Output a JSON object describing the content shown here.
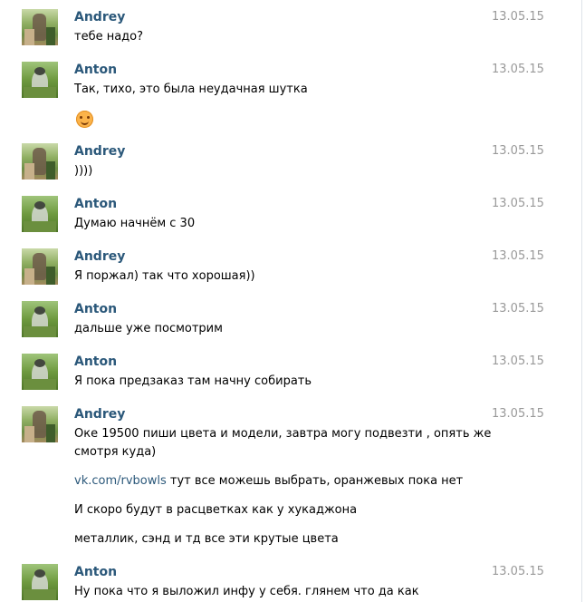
{
  "messages": [
    {
      "author": "Andrey",
      "date": "13.05.15",
      "lines": [
        "тебе надо?"
      ]
    },
    {
      "author": "Anton",
      "date": "13.05.15",
      "lines": [
        "Так, тихо, это была неудачная шутка"
      ],
      "emoji": "smile-emoji"
    },
    {
      "author": "Andrey",
      "date": "13.05.15",
      "lines": [
        "))))"
      ]
    },
    {
      "author": "Anton",
      "date": "13.05.15",
      "lines": [
        "Думаю начнём с 30"
      ]
    },
    {
      "author": "Andrey",
      "date": "13.05.15",
      "lines": [
        "Я поржал) так что хорошая))"
      ]
    },
    {
      "author": "Anton",
      "date": "13.05.15",
      "lines": [
        "дальше уже посмотрим"
      ]
    },
    {
      "author": "Anton",
      "date": "13.05.15",
      "lines": [
        "Я пока предзаказ там начну собирать"
      ]
    },
    {
      "author": "Andrey",
      "date": "13.05.15",
      "lines": [
        "Оке 19500 пиши цвета и модели, завтра могу подвезти , опять же",
        "смотря куда)"
      ],
      "followups": [
        {
          "link": "vk.com/rvbowls",
          "text": " тут все можешь выбрать, оранжевых пока нет"
        },
        {
          "text": "И скоро будут в расцветках как у хукаджона"
        },
        {
          "text": "металлик, сэнд и тд все эти крутые цвета"
        }
      ]
    },
    {
      "author": "Anton",
      "date": "13.05.15",
      "lines": [
        "Ну пока что я выложил инфу у себя. глянем что да как"
      ]
    }
  ]
}
